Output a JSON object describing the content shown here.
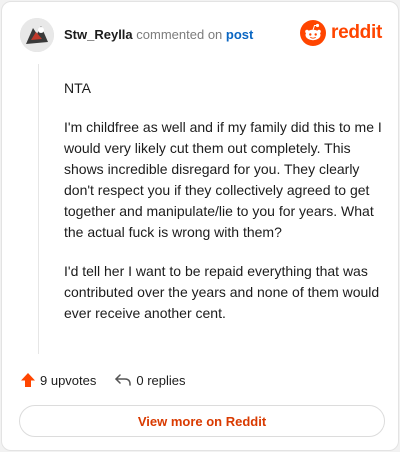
{
  "header": {
    "username": "Stw_Reylla",
    "commented_text": "commented on",
    "post_link": "post",
    "brand": "reddit"
  },
  "comment": {
    "paragraphs": [
      "NTA",
      "I'm childfree as well and if my family did this to me I would very likely cut them out completely. This shows incredible disregard for you. They clearly don't respect you if they collectively agreed to get together and manipulate/lie to you for years. What the actual fuck is wrong with them?",
      "I'd tell her I want to be repaid everything that was contributed over the years and none of them would ever receive another cent."
    ]
  },
  "actions": {
    "upvotes": "9 upvotes",
    "replies": "0 replies"
  },
  "view_more": "View more on Reddit",
  "colors": {
    "brand": "#ff4500",
    "link": "#0a66c2",
    "view_more": "#d93a00"
  },
  "icons": [
    "avatar",
    "reddit-logo-icon",
    "upvote-arrow-icon",
    "reply-icon"
  ]
}
